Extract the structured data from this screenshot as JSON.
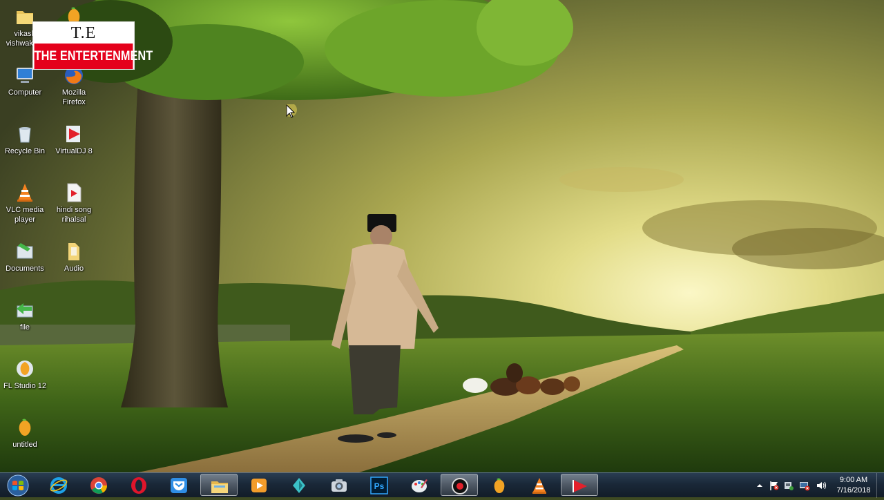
{
  "desktop": {
    "icons": [
      {
        "label": "vikash\nvishwaka...",
        "icon": "user-folder-icon"
      },
      {
        "label": "",
        "icon": "fl-studio-icon"
      },
      {
        "label": "Computer",
        "icon": "computer-icon"
      },
      {
        "label": "Mozilla\nFirefox",
        "icon": "firefox-icon"
      },
      {
        "label": "Recycle Bin",
        "icon": "recycle-bin-icon"
      },
      {
        "label": "VirtualDJ 8",
        "icon": "virtualdj-icon"
      },
      {
        "label": "VLC media\nplayer",
        "icon": "vlc-icon"
      },
      {
        "label": "hindi song\nrihalsal",
        "icon": "media-file-icon"
      },
      {
        "label": "Documents",
        "icon": "documents-icon"
      },
      {
        "label": "Audio",
        "icon": "folder-icon"
      },
      {
        "label": "file",
        "icon": "shortcut-icon"
      },
      {
        "label": "FL Studio 12",
        "icon": "fl-studio-icon"
      },
      {
        "label": "untitled",
        "icon": "fl-project-icon"
      }
    ]
  },
  "watermark": {
    "line1": "T.E",
    "line2": "THE ENTERTENMENT"
  },
  "taskbar": {
    "apps": [
      {
        "name": "internet-explorer",
        "active": false
      },
      {
        "name": "chrome",
        "active": false
      },
      {
        "name": "opera",
        "active": false
      },
      {
        "name": "pocket",
        "active": false
      },
      {
        "name": "file-explorer",
        "active": true
      },
      {
        "name": "media-player",
        "active": false
      },
      {
        "name": "filmora",
        "active": false
      },
      {
        "name": "camera",
        "active": false
      },
      {
        "name": "photoshop",
        "active": false
      },
      {
        "name": "paint",
        "active": false
      },
      {
        "name": "screen-recorder",
        "active": true
      },
      {
        "name": "fl-studio",
        "active": false
      },
      {
        "name": "vlc",
        "active": false
      },
      {
        "name": "virtualdj",
        "active": true
      }
    ],
    "photoshop_label": "Ps",
    "clock_time": "9:00 AM",
    "clock_date": "7/16/2018"
  },
  "colors": {
    "taskbar": "#1a2838",
    "watermark_red": "#e4001b",
    "sky": "#c9c45a",
    "grass": "#4f7a1e"
  }
}
